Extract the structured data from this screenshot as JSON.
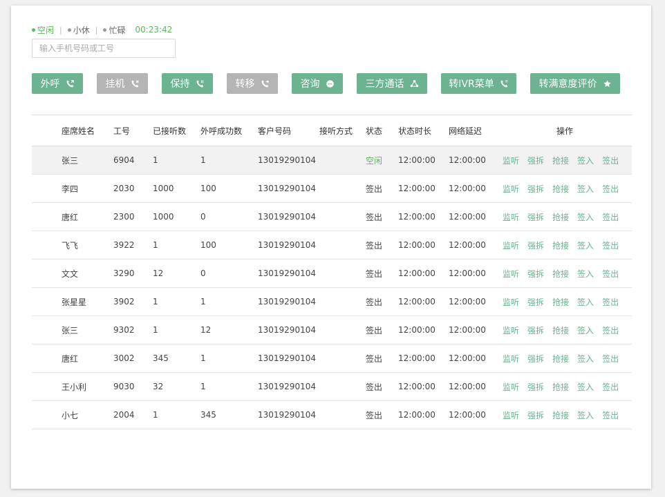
{
  "status": {
    "options": [
      {
        "label": "空闲"
      },
      {
        "label": "小休"
      },
      {
        "label": "忙碌"
      }
    ],
    "separator": "|",
    "timer": "00:23:42"
  },
  "search": {
    "placeholder": "输入手机号码或工号"
  },
  "toolbar": {
    "buttons": [
      {
        "label": "外呼",
        "icon": "phone-icon"
      },
      {
        "label": "挂机",
        "icon": "hangup-icon"
      },
      {
        "label": "保持",
        "icon": "hold-icon"
      },
      {
        "label": "转移",
        "icon": "transfer-icon"
      },
      {
        "label": "咨询",
        "icon": "chat-icon"
      },
      {
        "label": "三方通话",
        "icon": "conference-icon"
      },
      {
        "label": "转IVR菜单",
        "icon": "ivr-icon"
      },
      {
        "label": "转满意度评价",
        "icon": "rating-icon"
      }
    ]
  },
  "table": {
    "headers": {
      "name": "座席姓名",
      "id": "工号",
      "answered": "已接听数",
      "outbound": "外呼成功数",
      "customer": "客户号码",
      "mode": "接听方式",
      "state": "状态",
      "duration": "状态时长",
      "latency": "网络延迟",
      "ops": "操作"
    },
    "ops": [
      "监听",
      "强拆",
      "抢接",
      "签入",
      "签出"
    ],
    "rows": [
      {
        "name": "张三",
        "id": "6904",
        "answered": "1",
        "outbound": "1",
        "customer": "13019290104",
        "mode": "",
        "state": "空闲",
        "duration": "12:00:00",
        "latency": "12:00:00"
      },
      {
        "name": "李四",
        "id": "2030",
        "answered": "1000",
        "outbound": "100",
        "customer": "13019290104",
        "mode": "",
        "state": "签出",
        "duration": "12:00:00",
        "latency": "12:00:00"
      },
      {
        "name": "唐红",
        "id": "2300",
        "answered": "1000",
        "outbound": "0",
        "customer": "13019290104",
        "mode": "",
        "state": "签出",
        "duration": "12:00:00",
        "latency": "12:00:00"
      },
      {
        "name": "飞飞",
        "id": "3922",
        "answered": "1",
        "outbound": "100",
        "customer": "13019290104",
        "mode": "",
        "state": "签出",
        "duration": "12:00:00",
        "latency": "12:00:00"
      },
      {
        "name": "文文",
        "id": "3290",
        "answered": "12",
        "outbound": "0",
        "customer": "13019290104",
        "mode": "",
        "state": "签出",
        "duration": "12:00:00",
        "latency": "12:00:00"
      },
      {
        "name": "张星星",
        "id": "3902",
        "answered": "1",
        "outbound": "1",
        "customer": "13019290104",
        "mode": "",
        "state": "签出",
        "duration": "12:00:00",
        "latency": "12:00:00"
      },
      {
        "name": "张三",
        "id": "9302",
        "answered": "1",
        "outbound": "12",
        "customer": "13019290104",
        "mode": "",
        "state": "签出",
        "duration": "12:00:00",
        "latency": "12:00:00"
      },
      {
        "name": "唐红",
        "id": "3002",
        "answered": "345",
        "outbound": "1",
        "customer": "13019290104",
        "mode": "",
        "state": "签出",
        "duration": "12:00:00",
        "latency": "12:00:00"
      },
      {
        "name": "王小利",
        "id": "9030",
        "answered": "32",
        "outbound": "1",
        "customer": "13019290104",
        "mode": "",
        "state": "签出",
        "duration": "12:00:00",
        "latency": "12:00:00"
      },
      {
        "name": "小七",
        "id": "2004",
        "answered": "1",
        "outbound": "345",
        "customer": "13019290104",
        "mode": "",
        "state": "签出",
        "duration": "12:00:00",
        "latency": "12:00:00"
      }
    ]
  },
  "colors": {
    "accent": "#6bb391",
    "status_green": "#5cb85c",
    "disabled": "#b4b4b4"
  }
}
